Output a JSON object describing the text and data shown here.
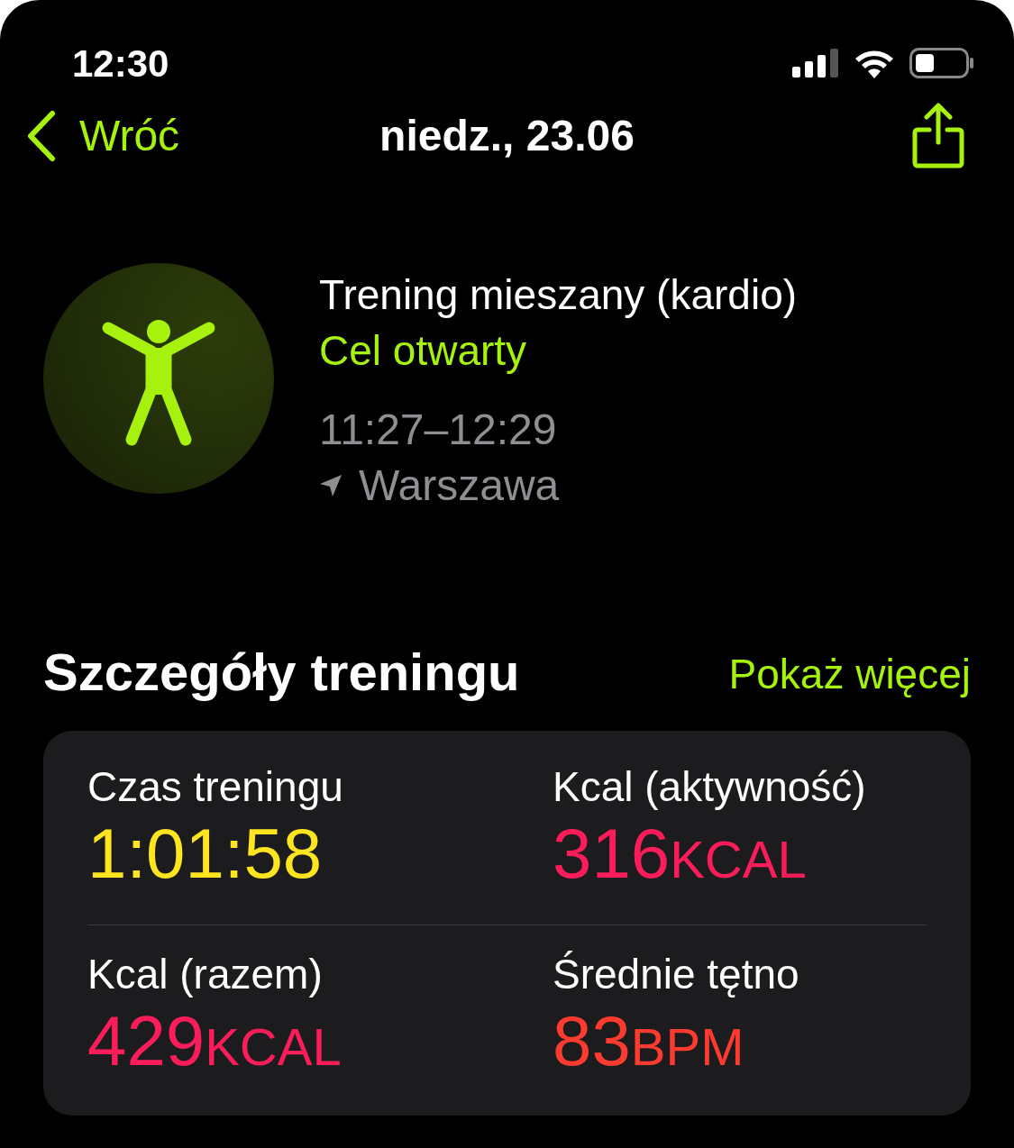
{
  "status_bar": {
    "time": "12:30"
  },
  "nav": {
    "back": "Wróć",
    "title": "niedz., 23.06"
  },
  "workout": {
    "name": "Trening mieszany (kardio)",
    "goal": "Cel otwarty",
    "time_range": "11:27–12:29",
    "location": "Warszawa"
  },
  "section": {
    "title": "Szczegóły treningu",
    "link": "Pokaż więcej"
  },
  "metrics": [
    {
      "label": "Czas treningu",
      "value": "1:01:58",
      "color": "#ffe51f"
    },
    {
      "label": "Kcal (aktywność)",
      "value": "316",
      "unit": "KCAL",
      "color": "#fb1d5a"
    },
    {
      "label": "Kcal (razem)",
      "value": "429",
      "unit": "KCAL",
      "color": "#fb1d5a"
    },
    {
      "label": "Średnie tętno",
      "value": "83",
      "unit": "BPM",
      "color": "#ff3b2f"
    }
  ]
}
